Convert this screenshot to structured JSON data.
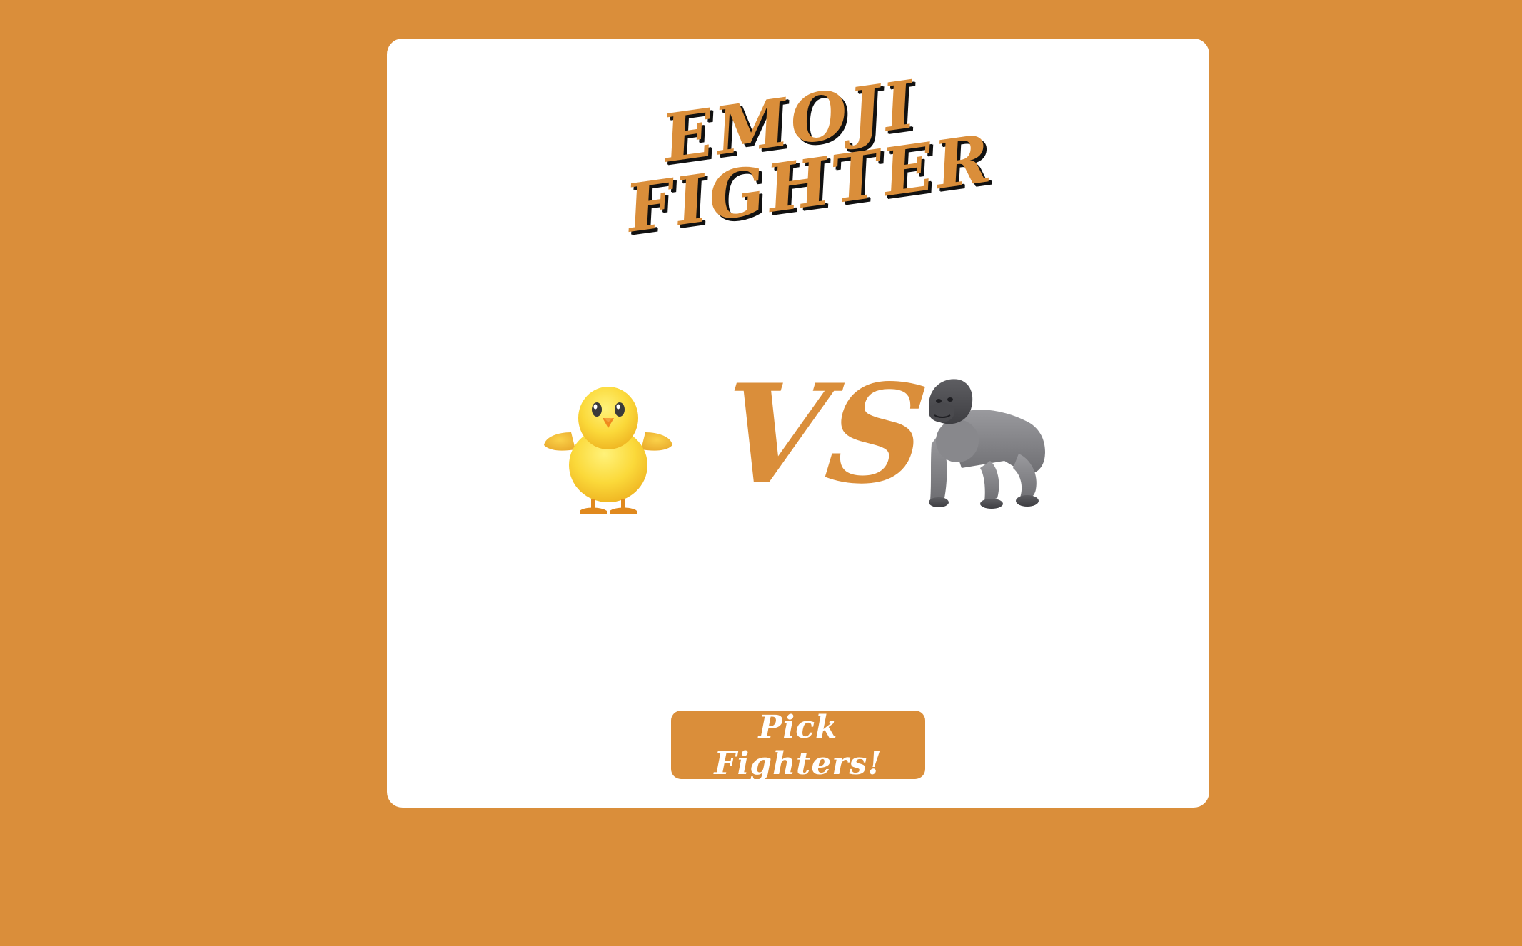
{
  "app": {
    "title_line1": "Emoji",
    "title_line2": "Fighter"
  },
  "arena": {
    "left_fighter": "chick-icon",
    "right_fighter": "gorilla-icon",
    "versus_label": "VS"
  },
  "controls": {
    "pick_label": "Pick Fighters!"
  },
  "colors": {
    "background": "#DA8E3A",
    "card": "#FFFFFF",
    "accent": "#DA8E3A",
    "title_shadow": "#111111"
  }
}
